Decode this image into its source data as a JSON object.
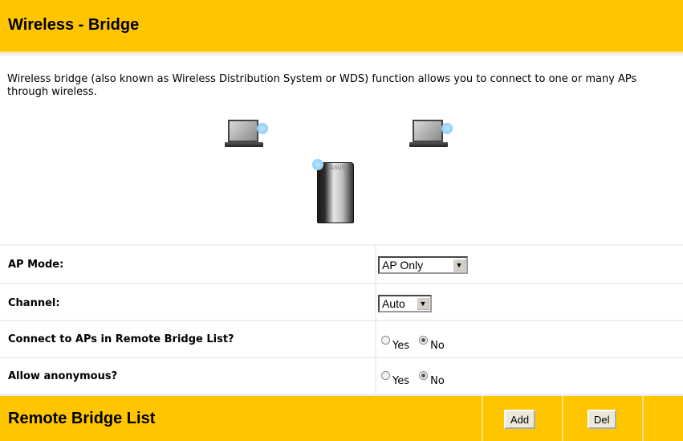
{
  "header": {
    "title": "Wireless - Bridge"
  },
  "description": "Wireless bridge (also known as Wireless Distribution System or WDS) function allows you to connect to one or many APs through wireless.",
  "illustration": {
    "router_logo": "ASUS"
  },
  "settings": {
    "ap_mode": {
      "label": "AP Mode:",
      "value": "AP Only"
    },
    "channel": {
      "label": "Channel:",
      "value": "Auto"
    },
    "connect_remote": {
      "label": "Connect to APs in Remote Bridge List?",
      "yes": "Yes",
      "no": "No",
      "selected": "No"
    },
    "anonymous": {
      "label": "Allow anonymous?",
      "yes": "Yes",
      "no": "No",
      "selected": "No"
    }
  },
  "remote_list": {
    "title": "Remote Bridge List",
    "add_label": "Add",
    "del_label": "Del"
  },
  "colors": {
    "header_bg": "#ffc600",
    "divider": "#efefef"
  }
}
